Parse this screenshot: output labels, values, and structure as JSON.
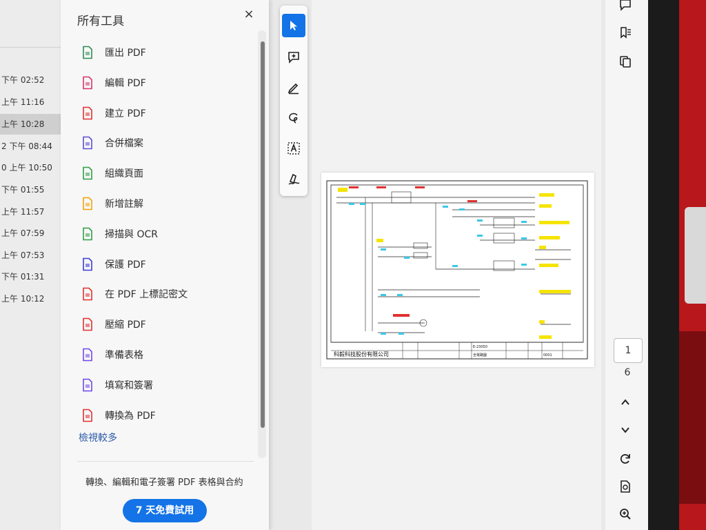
{
  "file_list": {
    "times": [
      "下午 02:52",
      "上午 11:16",
      "上午 10:28",
      "2 下午 08:44",
      "0 上午 10:50",
      "下午 01:55",
      "上午 11:57",
      "上午 07:59",
      "上午 07:53",
      "下午 01:31",
      "上午 10:12"
    ],
    "selected_index": 2
  },
  "tools_panel": {
    "title": "所有工具",
    "close_symbol": "×",
    "items": [
      {
        "label": "匯出 PDF",
        "icon": "export-pdf-icon",
        "color": "#2e8b57"
      },
      {
        "label": "編輯 PDF",
        "icon": "edit-pdf-icon",
        "color": "#d6336c"
      },
      {
        "label": "建立 PDF",
        "icon": "create-pdf-icon",
        "color": "#e03131"
      },
      {
        "label": "合併檔案",
        "icon": "combine-files-icon",
        "color": "#5b4dd1"
      },
      {
        "label": "組織頁面",
        "icon": "organize-pages-icon",
        "color": "#2f9e44"
      },
      {
        "label": "新增註解",
        "icon": "add-comment-icon",
        "color": "#f0a30a"
      },
      {
        "label": "掃描與 OCR",
        "icon": "scan-ocr-icon",
        "color": "#2f9e44"
      },
      {
        "label": "保護 PDF",
        "icon": "protect-pdf-icon",
        "color": "#3b3bd6"
      },
      {
        "label": "在 PDF 上標記密文",
        "icon": "redact-icon",
        "color": "#e03131"
      },
      {
        "label": "壓縮 PDF",
        "icon": "compress-pdf-icon",
        "color": "#e03131"
      },
      {
        "label": "準備表格",
        "icon": "prepare-form-icon",
        "color": "#7048e8"
      },
      {
        "label": "填寫和簽署",
        "icon": "fill-sign-icon",
        "color": "#7048e8"
      },
      {
        "label": "轉換為 PDF",
        "icon": "convert-pdf-icon",
        "color": "#e03131"
      }
    ],
    "view_more": "檢視較多",
    "promo_text": "轉換、編輯和電子簽署 PDF 表格與合約",
    "trial_button": "7 天免費試用"
  },
  "toolbar": {
    "tools": [
      "select-cursor-icon",
      "add-comment-icon",
      "highlight-pen-icon",
      "lasso-draw-icon",
      "text-select-icon",
      "sign-icon"
    ],
    "active_index": 0
  },
  "document": {
    "company": "科毅科技股份有限公司",
    "drawing_no": "E-23050",
    "title_cell": "全電路圖",
    "sheet": "0001"
  },
  "navigation": {
    "current_page": "1",
    "total_pages": "6"
  },
  "colors": {
    "accent": "#1473e6",
    "link": "#2c5aa8"
  }
}
